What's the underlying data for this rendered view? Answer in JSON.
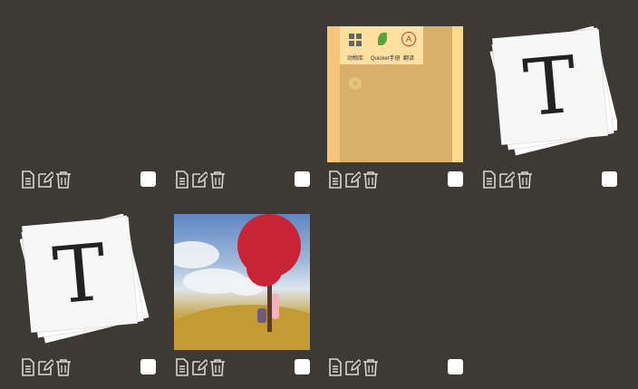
{
  "top_text": "",
  "tiles": [
    {
      "id": "tile-1",
      "type": "empty"
    },
    {
      "id": "tile-2",
      "type": "empty"
    },
    {
      "id": "tile-3",
      "type": "phone-screenshot",
      "apps": [
        "动物库",
        "Quicker手册",
        "翻译"
      ]
    },
    {
      "id": "tile-4",
      "type": "text-file-stack",
      "letter": "T"
    },
    {
      "id": "tile-5",
      "type": "text-file-stack",
      "letter": "T"
    },
    {
      "id": "tile-6",
      "type": "landscape-photo"
    },
    {
      "id": "tile-7",
      "type": "empty"
    }
  ],
  "toolbar_icons": [
    "document-icon",
    "edit-icon",
    "trash-icon"
  ],
  "colors": {
    "background": "#3d3a35",
    "icon": "#d8d6d2",
    "checkbox": "#ffffff"
  }
}
